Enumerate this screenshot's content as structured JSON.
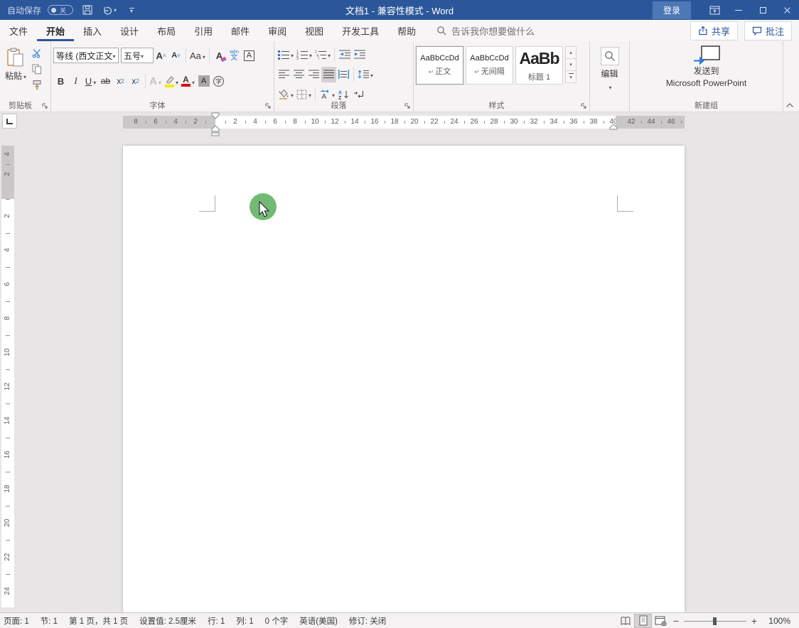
{
  "titlebar": {
    "autosave_label": "自动保存",
    "autosave_state": "关",
    "title": "文档1  -  兼容性模式  -  Word",
    "signin_label": "登录"
  },
  "tabs": {
    "file": "文件",
    "home": "开始",
    "insert": "插入",
    "design": "设计",
    "layout": "布局",
    "references": "引用",
    "mailings": "邮件",
    "review": "审阅",
    "view": "视图",
    "developer": "开发工具",
    "help": "帮助"
  },
  "search": {
    "placeholder": "告诉我你想要做什么"
  },
  "actions": {
    "share": "共享",
    "comments": "批注"
  },
  "ribbon": {
    "clipboard": {
      "paste": "粘贴",
      "group_label": "剪贴板"
    },
    "font": {
      "name_value": "等线 (西文正文",
      "size_value": "五号",
      "group_label": "字体",
      "bold": "B",
      "italic": "I",
      "underline": "U",
      "strikethrough": "ab",
      "subscript_base": "x",
      "subscript_mark": "2",
      "superscript_base": "x",
      "superscript_mark": "2",
      "grow_font": "A",
      "shrink_font": "A",
      "change_case": "Aa",
      "clear_format": "A",
      "phonetic_top": "wén",
      "phonetic_char": "文",
      "char_border": "A",
      "text_effects": "A",
      "font_color": "A",
      "char_shading": "A",
      "enclose": "字"
    },
    "paragraph": {
      "group_label": "段落"
    },
    "styles": {
      "group_label": "样式",
      "items": [
        {
          "preview": "AaBbCcDd",
          "mark": "↵",
          "label": "正文"
        },
        {
          "preview": "AaBbCcDd",
          "mark": "↵",
          "label": "无间隔"
        },
        {
          "preview": "AaBb",
          "mark": "",
          "label": "标题 1"
        }
      ]
    },
    "editing": {
      "label": "编辑"
    },
    "new_group": {
      "button_line1": "发送到",
      "button_line2": "Microsoft PowerPoint",
      "group_label": "新建组"
    }
  },
  "ruler": {
    "h_margin_left": [
      "8",
      "6",
      "4",
      "2"
    ],
    "h_text_area": [
      "2",
      "4",
      "6",
      "8",
      "10",
      "12",
      "14",
      "16",
      "18",
      "20",
      "22",
      "24",
      "26",
      "28",
      "30",
      "32",
      "34",
      "36",
      "38",
      "40"
    ],
    "h_margin_right": [
      "42",
      "44",
      "46"
    ],
    "v_margin_top": [
      "4",
      "2"
    ],
    "v_text_area": [
      "2",
      "4",
      "6",
      "8",
      "10",
      "12",
      "14",
      "16",
      "18",
      "20",
      "22",
      "24"
    ]
  },
  "statusbar": {
    "page": "页面: 1",
    "section": "节: 1",
    "page_of": "第 1 页，共 1 页",
    "setting": "设置值: 2.5厘米",
    "line": "行: 1",
    "column": "列: 1",
    "words": "0 个字",
    "language": "英语(美国)",
    "revisions": "修订: 关闭",
    "zoom": "100%"
  },
  "colors": {
    "accent": "#2b579a",
    "touch_indicator": "#72ba73",
    "highlight_swatch": "#f3eb00",
    "font_color_swatch": "#e00000"
  }
}
